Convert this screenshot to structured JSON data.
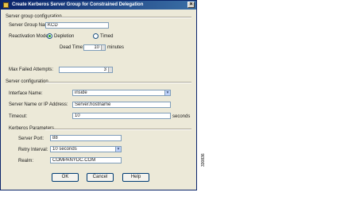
{
  "window": {
    "title": "Create Kerberos Server Group for Constrained Delegation"
  },
  "server_group": {
    "section_label": "Server group configuration",
    "name_label": "Server Group Name:",
    "name_value": "KCD",
    "reactivation_label": "Reactivation Mode:",
    "depletion_label": "Depletion",
    "timed_label": "Timed",
    "dead_time_label": "Dead Time:",
    "dead_time_value": "10",
    "minutes_label": "minutes",
    "max_failed_label": "Max Failed Attempts:",
    "max_failed_value": "3"
  },
  "server_config": {
    "section_label": "Server configuration",
    "interface_label": "Interface Name:",
    "interface_value": "inside",
    "server_name_label": "Server Name or IP Address:",
    "server_name_value": "Server.hostname",
    "timeout_label": "Timeout:",
    "timeout_value": "10",
    "seconds_label": "seconds"
  },
  "kerberos": {
    "section_label": "Kerberos Parameters",
    "port_label": "Server Port:",
    "port_value": "88",
    "retry_label": "Retry Interval:",
    "retry_value": "10 seconds",
    "realm_label": "Realm:",
    "realm_value": "COMPANYDC.COM"
  },
  "buttons": {
    "ok": "OK",
    "cancel": "Cancel",
    "help": "Help"
  },
  "figure_id": "330836",
  "colors": {
    "title_bar": "#0a246a",
    "dialog_bg": "#ece9d8"
  }
}
